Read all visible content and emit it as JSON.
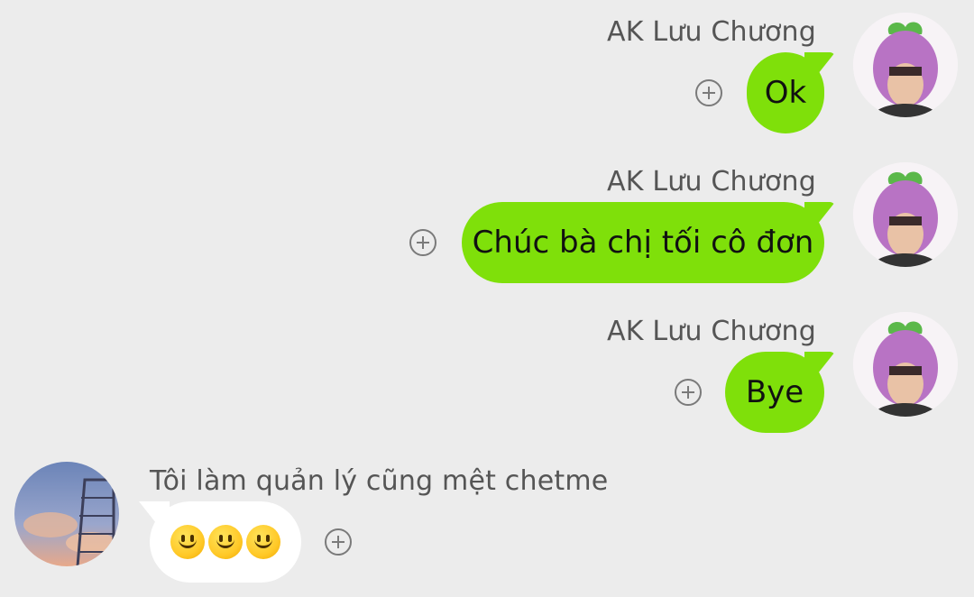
{
  "messages": [
    {
      "sender": "AK Lưu Chương",
      "text": "Ok",
      "avatar_icon": "eggplant-hat-avatar-icon"
    },
    {
      "sender": "AK Lưu Chương",
      "text": "Chúc bà chị tối cô đơn",
      "avatar_icon": "eggplant-hat-avatar-icon"
    },
    {
      "sender": "AK Lưu Chương",
      "text": "Bye",
      "avatar_icon": "eggplant-hat-avatar-icon"
    },
    {
      "sender": "Tôi làm quản lý cũng mệt chetme",
      "text": "🙂🙂🙂",
      "avatar_icon": "sky-building-avatar-icon"
    }
  ],
  "colors": {
    "background": "#ececec",
    "outgoing_bubble": "#7fe00a",
    "incoming_bubble": "#ffffff",
    "sender_name": "#555555"
  },
  "icons": {
    "add_reaction": "add-reaction-icon"
  }
}
